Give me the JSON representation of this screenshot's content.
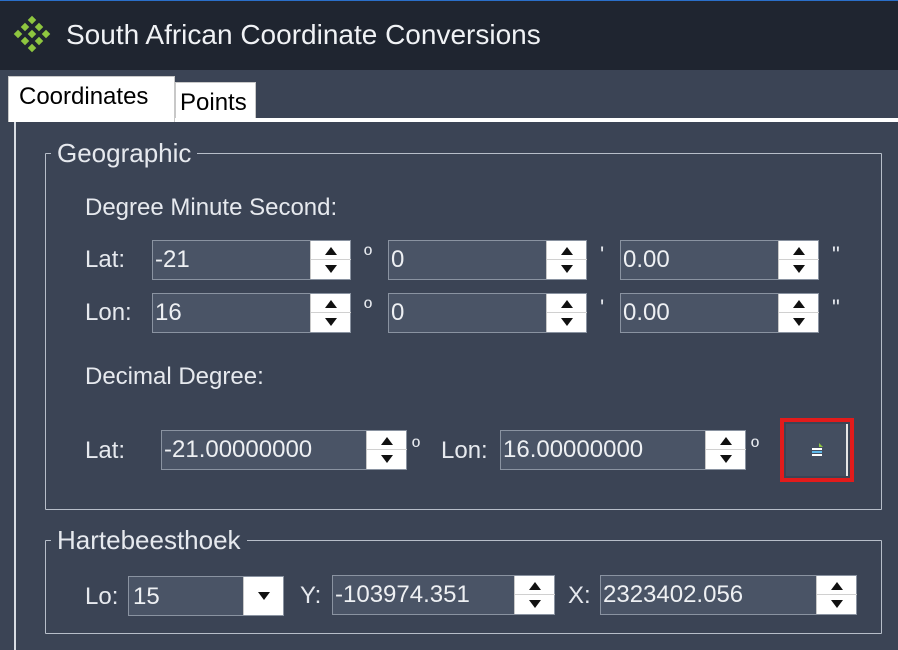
{
  "window": {
    "title": "South African Coordinate Conversions",
    "app_icon": "diamond-grid-icon"
  },
  "tabs": [
    {
      "label": "Coordinates",
      "active": true
    },
    {
      "label": "Points",
      "active": false
    }
  ],
  "geographic": {
    "title": "Geographic",
    "dms": {
      "heading": "Degree Minute Second:",
      "lat": {
        "label": "Lat:",
        "degrees": "-21",
        "minutes": "0",
        "seconds": "0.00"
      },
      "lon": {
        "label": "Lon:",
        "degrees": "16",
        "minutes": "0",
        "seconds": "0.00"
      },
      "units": {
        "degree": "º",
        "minute": "'",
        "second": "\""
      }
    },
    "decimal": {
      "heading": "Decimal Degree:",
      "lat_label": "Lat:",
      "lat_value": "-21.00000000",
      "lon_label": "Lon:",
      "lon_value": "16.00000000",
      "unit": "º",
      "copy_icon": "copy-to-clipboard-icon"
    }
  },
  "hartebeesthoek": {
    "title": "Hartebeesthoek",
    "lo_label": "Lo:",
    "lo_value": "15",
    "y_label": "Y:",
    "y_value": "-103974.351",
    "x_label": "X:",
    "x_value": "2323402.056"
  },
  "colors": {
    "highlight": "#e21b1b",
    "accent_green": "#8ec63f"
  }
}
